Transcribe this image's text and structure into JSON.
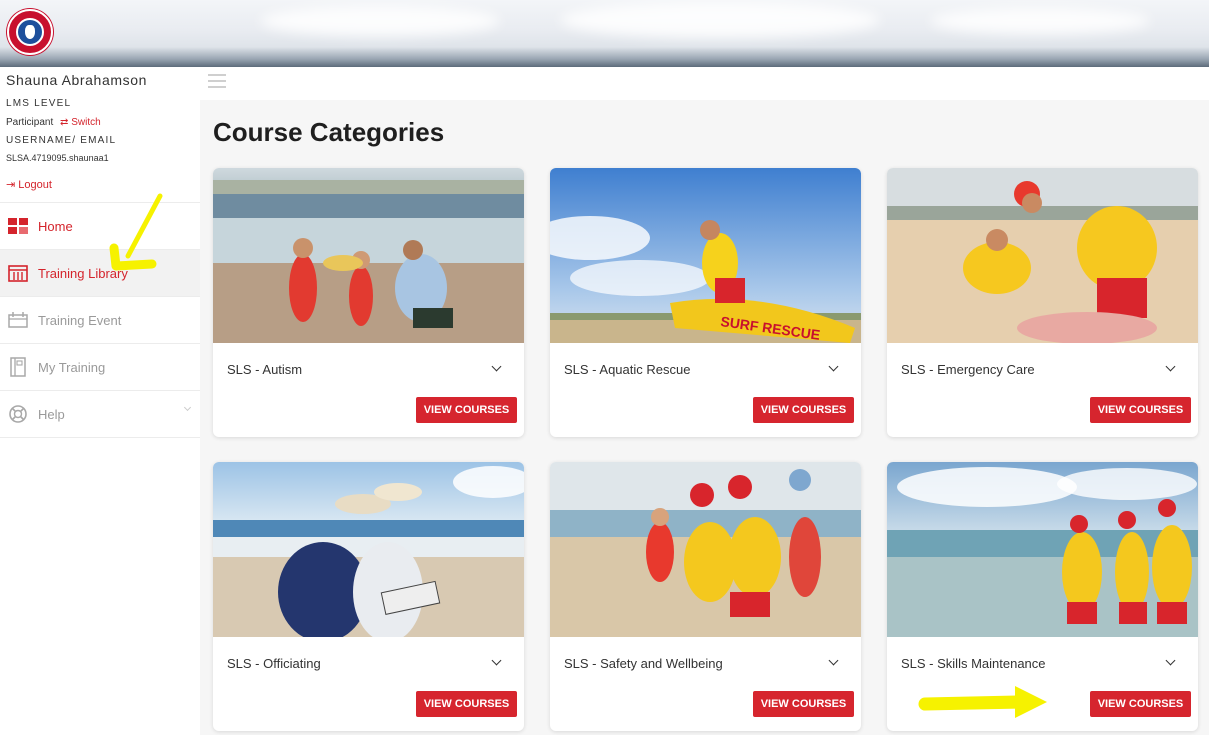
{
  "user": {
    "name": "Shauna Abrahamson",
    "lms_level_label": "LMS LEVEL",
    "role": "Participant",
    "switch_label": "Switch",
    "username_label": "USERNAME/ EMAIL",
    "username_value": "SLSA.4719095.shaunaa1",
    "logout_label": "Logout"
  },
  "sidebar": {
    "items": [
      {
        "label": "Home",
        "icon": "home-icon"
      },
      {
        "label": "Training Library",
        "icon": "library-icon"
      },
      {
        "label": "Training Event",
        "icon": "event-icon"
      },
      {
        "label": "My Training",
        "icon": "my-training-icon"
      },
      {
        "label": "Help",
        "icon": "help-icon"
      }
    ]
  },
  "main": {
    "title": "Course Categories",
    "button_label": "VIEW COURSES",
    "cards": [
      {
        "title": "SLS - Autism"
      },
      {
        "title": "SLS - Aquatic Rescue"
      },
      {
        "title": "SLS - Emergency Care"
      },
      {
        "title": "SLS - Officiating"
      },
      {
        "title": "SLS - Safety and Wellbeing"
      },
      {
        "title": "SLS - Skills Maintenance"
      }
    ]
  },
  "colors": {
    "accent_red": "#d6252e",
    "background": "#f6f6f6",
    "annotation_yellow": "#f6f200"
  }
}
